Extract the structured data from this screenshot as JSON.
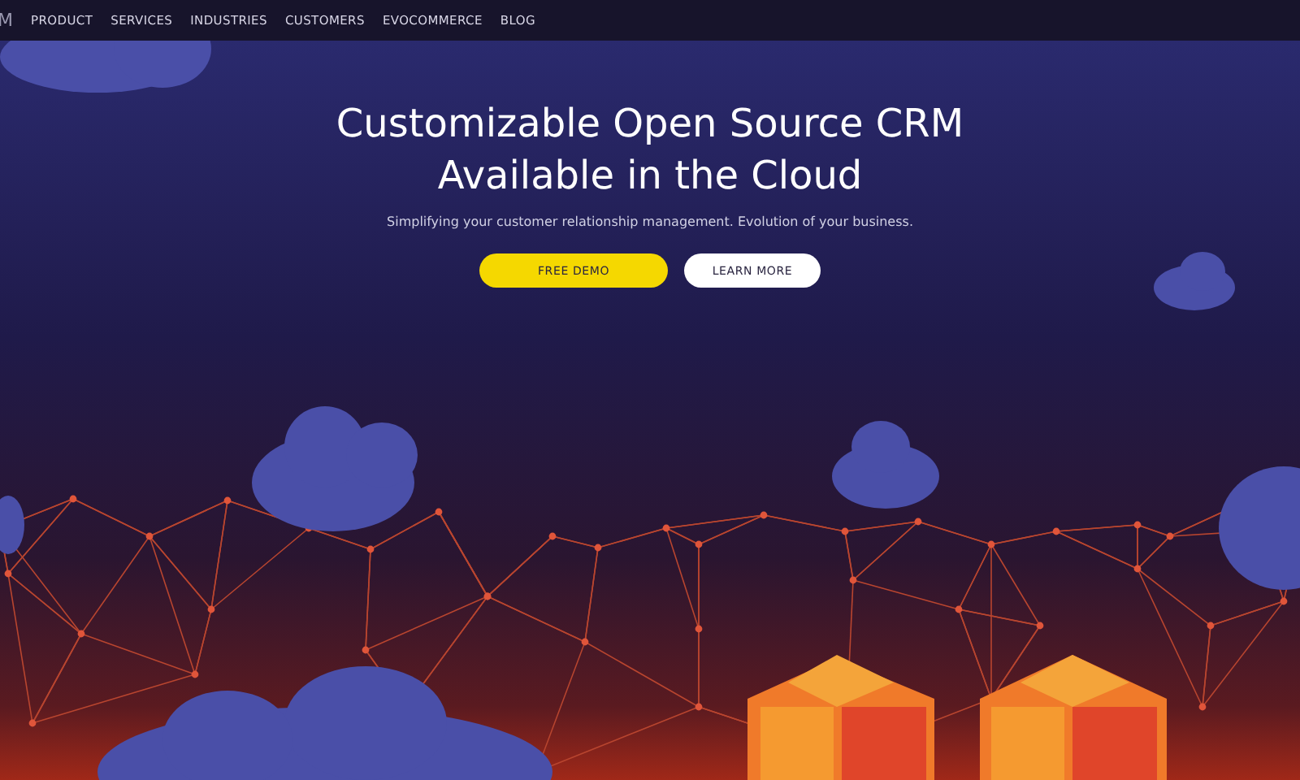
{
  "nav": {
    "logo": "M",
    "items": [
      "PRODUCT",
      "SERVICES",
      "INDUSTRIES",
      "CUSTOMERS",
      "EVOCOMMERCE",
      "BLOG"
    ]
  },
  "hero": {
    "title_lines": [
      "Customizable Open Source CRM",
      "Available in the Cloud"
    ],
    "subtitle": "Simplifying your customer relationship management. Evolution of your business.",
    "buttons": [
      {
        "label": "FREE DEMO",
        "kind": "primary"
      },
      {
        "label": "LEARN MORE",
        "kind": "secondary"
      }
    ]
  }
}
